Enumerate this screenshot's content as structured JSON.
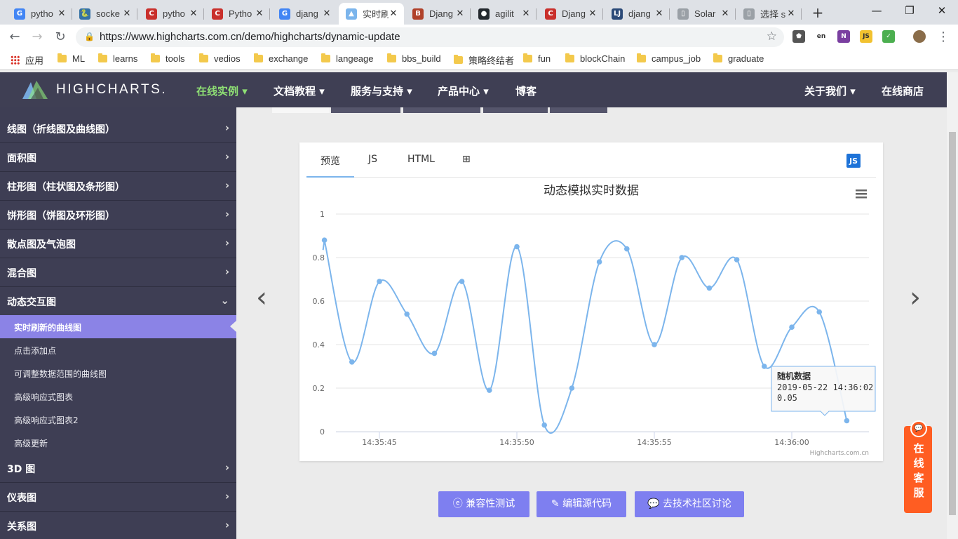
{
  "browser": {
    "tabs": [
      {
        "title": "pytho",
        "icon": "google-icon",
        "color": "#4285f4",
        "glyph": "G"
      },
      {
        "title": "socke",
        "icon": "python-icon",
        "color": "#3572a5",
        "glyph": "🐍"
      },
      {
        "title": "pytho",
        "icon": "csdn-icon",
        "color": "#c9302c",
        "glyph": "C"
      },
      {
        "title": "Pytho",
        "icon": "csdn-icon",
        "color": "#c9302c",
        "glyph": "C"
      },
      {
        "title": "djang",
        "icon": "google-icon",
        "color": "#4285f4",
        "glyph": "G"
      },
      {
        "title": "实时刷",
        "icon": "highcharts-icon",
        "color": "#7cb5ec",
        "glyph": "▲"
      },
      {
        "title": "Djang",
        "icon": "bootcss-icon",
        "color": "#b0412a",
        "glyph": "B"
      },
      {
        "title": "agilit",
        "icon": "github-icon",
        "color": "#24292e",
        "glyph": "●"
      },
      {
        "title": "Djang",
        "icon": "csdn-icon",
        "color": "#c9302c",
        "glyph": "C"
      },
      {
        "title": "djang",
        "icon": "liujiang-icon",
        "color": "#2b4a78",
        "glyph": "LJ"
      },
      {
        "title": "Solar",
        "icon": "page-icon",
        "color": "#9aa0a6",
        "glyph": "▯"
      },
      {
        "title": "选择 s",
        "icon": "page-icon",
        "color": "#9aa0a6",
        "glyph": "▯"
      }
    ],
    "active_tab": 5,
    "url": "https://www.highcharts.com.cn/demo/highcharts/dynamic-update",
    "bookmarks": [
      "应用",
      "ML",
      "learns",
      "tools",
      "vedios",
      "exchange",
      "langeage",
      "bbs_build",
      "策略终结者",
      "fun",
      "blockChain",
      "campus_job",
      "graduate"
    ]
  },
  "site": {
    "logo_text": "HIGHCHARTS.",
    "nav": [
      {
        "label": "在线实例 ▾",
        "highlight": true
      },
      {
        "label": "文档教程 ▾",
        "highlight": false
      },
      {
        "label": "服务与支持 ▾",
        "highlight": false
      },
      {
        "label": "产品中心 ▾",
        "highlight": false
      },
      {
        "label": "博客",
        "highlight": false
      }
    ],
    "nav_right": [
      "关于我们 ▾",
      "在线商店"
    ]
  },
  "sidebar": {
    "sections": [
      {
        "label": "线图（折线图及曲线图）",
        "chevron": "›"
      },
      {
        "label": "面积图",
        "chevron": "›"
      },
      {
        "label": "柱形图（柱状图及条形图）",
        "chevron": "›"
      },
      {
        "label": "饼形图（饼图及环形图）",
        "chevron": "›"
      },
      {
        "label": "散点图及气泡图",
        "chevron": "›"
      },
      {
        "label": "混合图",
        "chevron": "›"
      },
      {
        "label": "动态交互图",
        "chevron": "⌄"
      }
    ],
    "sub_items": [
      "实时刷新的曲线图",
      "点击添加点",
      "可调整数据范围的曲线图",
      "高级响应式图表",
      "高级响应式图表2",
      "高级更新"
    ],
    "active_sub": 0,
    "sections_after": [
      {
        "label": "3D 图",
        "chevron": "›"
      },
      {
        "label": "仪表图",
        "chevron": "›"
      },
      {
        "label": "关系图",
        "chevron": "›"
      }
    ]
  },
  "demo": {
    "tabs": [
      "预览",
      "JS",
      "HTML",
      "⊞"
    ],
    "js_badge": "JS",
    "buttons": [
      "兼容性测试",
      "编辑源代码",
      "去技术社区讨论"
    ],
    "button_icons": [
      "ie-icon",
      "edit-icon",
      "chat-icon"
    ],
    "kefu_text": "在线客服"
  },
  "chart_data": {
    "type": "line",
    "title": "动态模拟实时数据",
    "xlabel": "",
    "ylabel": "",
    "credits": "Highcharts.com.cn",
    "ylim": [
      0,
      1
    ],
    "y_ticks": [
      "0",
      "0.2",
      "0.4",
      "0.6",
      "0.8",
      "1"
    ],
    "x_ticks": [
      "14:35:45",
      "14:35:50",
      "14:35:55",
      "14:36:00"
    ],
    "series": [
      {
        "name": "随机数据",
        "color": "#7cb5ec",
        "x": [
          "14:35:43",
          "14:35:44",
          "14:35:45",
          "14:35:46",
          "14:35:47",
          "14:35:48",
          "14:35:49",
          "14:35:50",
          "14:35:51",
          "14:35:52",
          "14:35:53",
          "14:35:54",
          "14:35:55",
          "14:35:56",
          "14:35:57",
          "14:35:58",
          "14:35:59",
          "14:36:00",
          "14:36:01",
          "14:36:02"
        ],
        "y_seconds_from_first_tick": [
          -1.7,
          -1,
          0,
          1,
          2,
          3,
          4,
          5,
          6,
          7,
          8,
          9,
          10,
          11,
          12,
          13,
          14,
          15,
          16,
          17,
          18,
          19
        ],
        "values": [
          0.88,
          0.32,
          0.69,
          0.54,
          0.36,
          0.69,
          0.19,
          0.85,
          0.03,
          0.2,
          0.78,
          0.84,
          0.4,
          0.8,
          0.66,
          0.79,
          0.3,
          0.48,
          0.55,
          0.05
        ]
      }
    ],
    "tooltip": {
      "series": "随机数据",
      "time": "2019-05-22 14:36:02",
      "value": "0.05"
    },
    "menu_icon": "hamburger-menu-icon"
  }
}
